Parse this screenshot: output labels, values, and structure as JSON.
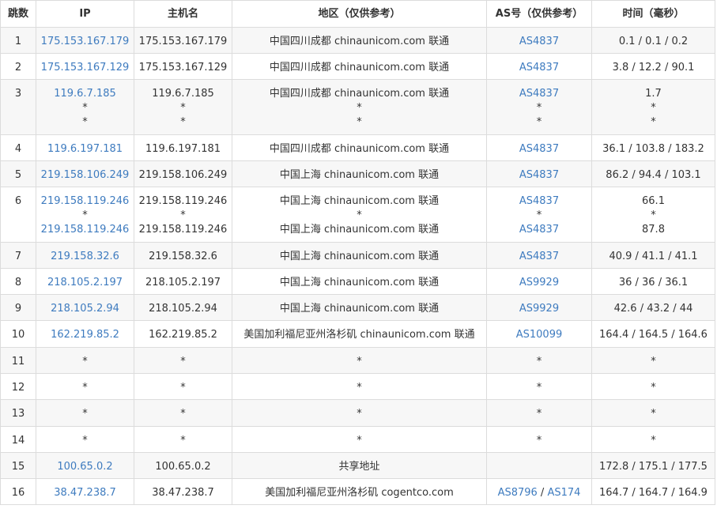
{
  "headers": [
    "跳数",
    "IP",
    "主机名",
    "地区（仅供参考）",
    "AS号（仅供参考）",
    "时间（毫秒）"
  ],
  "rows": [
    {
      "hop": "1",
      "ip": [
        "175.153.167.179"
      ],
      "host": [
        "175.153.167.179"
      ],
      "region": [
        "中国四川成都 chinaunicom.com 联通"
      ],
      "as": [
        [
          "AS4837"
        ]
      ],
      "time": [
        "0.1 / 0.1 / 0.2"
      ]
    },
    {
      "hop": "2",
      "ip": [
        "175.153.167.129"
      ],
      "host": [
        "175.153.167.129"
      ],
      "region": [
        "中国四川成都 chinaunicom.com 联通"
      ],
      "as": [
        [
          "AS4837"
        ]
      ],
      "time": [
        "3.8 / 12.2 / 90.1"
      ]
    },
    {
      "hop": "3",
      "ip": [
        "119.6.7.185",
        "*",
        "*"
      ],
      "host": [
        "119.6.7.185",
        "*",
        "*"
      ],
      "region": [
        "中国四川成都 chinaunicom.com 联通",
        "*",
        "*"
      ],
      "as": [
        [
          "AS4837"
        ],
        [
          "*"
        ],
        [
          "*"
        ]
      ],
      "time": [
        "1.7",
        "*",
        "*"
      ]
    },
    {
      "hop": "4",
      "ip": [
        "119.6.197.181"
      ],
      "host": [
        "119.6.197.181"
      ],
      "region": [
        "中国四川成都 chinaunicom.com 联通"
      ],
      "as": [
        [
          "AS4837"
        ]
      ],
      "time": [
        "36.1 / 103.8 / 183.2"
      ]
    },
    {
      "hop": "5",
      "ip": [
        "219.158.106.249"
      ],
      "host": [
        "219.158.106.249"
      ],
      "region": [
        "中国上海 chinaunicom.com 联通"
      ],
      "as": [
        [
          "AS4837"
        ]
      ],
      "time": [
        "86.2 / 94.4 / 103.1"
      ]
    },
    {
      "hop": "6",
      "ip": [
        "219.158.119.246",
        "*",
        "219.158.119.246"
      ],
      "host": [
        "219.158.119.246",
        "*",
        "219.158.119.246"
      ],
      "region": [
        "中国上海 chinaunicom.com 联通",
        "*",
        "中国上海 chinaunicom.com 联通"
      ],
      "as": [
        [
          "AS4837"
        ],
        [
          "*"
        ],
        [
          "AS4837"
        ]
      ],
      "time": [
        "66.1",
        "*",
        "87.8"
      ]
    },
    {
      "hop": "7",
      "ip": [
        "219.158.32.6"
      ],
      "host": [
        "219.158.32.6"
      ],
      "region": [
        "中国上海 chinaunicom.com 联通"
      ],
      "as": [
        [
          "AS4837"
        ]
      ],
      "time": [
        "40.9 / 41.1 / 41.1"
      ]
    },
    {
      "hop": "8",
      "ip": [
        "218.105.2.197"
      ],
      "host": [
        "218.105.2.197"
      ],
      "region": [
        "中国上海 chinaunicom.com 联通"
      ],
      "as": [
        [
          "AS9929"
        ]
      ],
      "time": [
        "36 / 36 / 36.1"
      ]
    },
    {
      "hop": "9",
      "ip": [
        "218.105.2.94"
      ],
      "host": [
        "218.105.2.94"
      ],
      "region": [
        "中国上海 chinaunicom.com 联通"
      ],
      "as": [
        [
          "AS9929"
        ]
      ],
      "time": [
        "42.6 / 43.2 / 44"
      ]
    },
    {
      "hop": "10",
      "ip": [
        "162.219.85.2"
      ],
      "host": [
        "162.219.85.2"
      ],
      "region": [
        "美国加利福尼亚州洛杉矶 chinaunicom.com 联通"
      ],
      "as": [
        [
          "AS10099"
        ]
      ],
      "time": [
        "164.4 / 164.5 / 164.6"
      ]
    },
    {
      "hop": "11",
      "ip": [
        "*"
      ],
      "host": [
        "*"
      ],
      "region": [
        "*"
      ],
      "as": [
        [
          "*"
        ]
      ],
      "time": [
        "*"
      ]
    },
    {
      "hop": "12",
      "ip": [
        "*"
      ],
      "host": [
        "*"
      ],
      "region": [
        "*"
      ],
      "as": [
        [
          "*"
        ]
      ],
      "time": [
        "*"
      ]
    },
    {
      "hop": "13",
      "ip": [
        "*"
      ],
      "host": [
        "*"
      ],
      "region": [
        "*"
      ],
      "as": [
        [
          "*"
        ]
      ],
      "time": [
        "*"
      ]
    },
    {
      "hop": "14",
      "ip": [
        "*"
      ],
      "host": [
        "*"
      ],
      "region": [
        "*"
      ],
      "as": [
        [
          "*"
        ]
      ],
      "time": [
        "*"
      ]
    },
    {
      "hop": "15",
      "ip": [
        "100.65.0.2"
      ],
      "host": [
        "100.65.0.2"
      ],
      "region": [
        "共享地址"
      ],
      "as": [
        [
          ""
        ]
      ],
      "time": [
        "172.8 / 175.1 / 177.5"
      ]
    },
    {
      "hop": "16",
      "ip": [
        "38.47.238.7"
      ],
      "host": [
        "38.47.238.7"
      ],
      "region": [
        "美国加利福尼亚州洛杉矶 cogentco.com"
      ],
      "as": [
        [
          "AS8796",
          "AS174"
        ]
      ],
      "time": [
        "164.7 / 164.7 / 164.9"
      ]
    }
  ],
  "colors": {
    "link": "#3e7bbf",
    "border": "#dcdcdc",
    "stripe": "#f7f7f7",
    "text": "#333333"
  }
}
